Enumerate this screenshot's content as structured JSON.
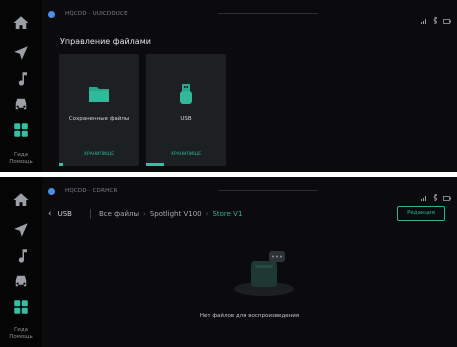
{
  "rail": {
    "items": [
      {
        "icon": "home-icon"
      },
      {
        "icon": "navigation-icon"
      },
      {
        "icon": "music-icon"
      },
      {
        "icon": "car-icon"
      },
      {
        "icon": "apps-grid-icon",
        "active": true
      }
    ],
    "footer_label_1": "Гида",
    "footer_label_2": "Помощь"
  },
  "screen1": {
    "status_text": "HQCDD · UUICDDUCE",
    "title": "Управление файлами",
    "cards": [
      {
        "label": "Сохраненные файлы",
        "sub": "ХРАНИЛИЩЕ",
        "icon": "folder-icon",
        "progress": 0.05
      },
      {
        "label": "USB",
        "sub": "ХРАНИЛИЩЕ",
        "icon": "usb-drive-icon",
        "progress": 0.3
      }
    ]
  },
  "screen2": {
    "status_text": "HQCDD · CDRHCR",
    "back_label": "USB",
    "crumbs": [
      "Все файлы",
      "Spotlight V100",
      "Store V1"
    ],
    "edit_label": "Редакция",
    "empty_text": "Нет файлов для воспроизведения"
  },
  "colors": {
    "accent": "#35c0a4",
    "background": "#0b0b0d",
    "card": "#1d2023"
  }
}
